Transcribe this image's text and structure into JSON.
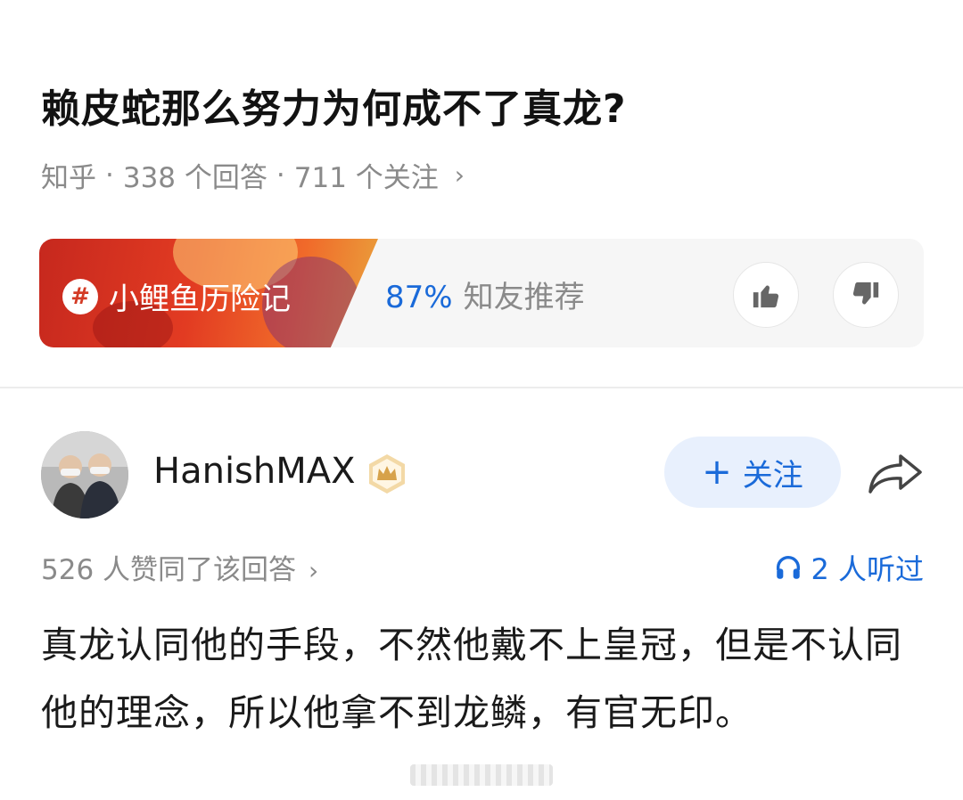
{
  "question": {
    "title": "赖皮蛇那么努力为何成不了真龙?",
    "source": "知乎",
    "answers": "338 个回答",
    "followers": "711 个关注"
  },
  "topic": {
    "tag": "小鲤鱼历险记",
    "recommend_pct": "87%",
    "recommend_label": "知友推荐"
  },
  "author": {
    "name": "HanishMAX",
    "follow_label": "关注"
  },
  "answer": {
    "likes": "526 人赞同了该回答",
    "listened": "2 人听过",
    "text": "真龙认同他的手段，不然他戴不上皇冠，但是不认同他的理念，所以他拿不到龙鳞，有官无印。"
  },
  "colors": {
    "accent": "#1a6ad9",
    "meta_gray": "#8a8a8a",
    "follow_bg": "#e8f0fd",
    "topic_red": "#d33b25"
  },
  "icons": [
    "hash-icon",
    "thumbs-up-icon",
    "thumbs-down-icon",
    "crown-badge-icon",
    "share-icon",
    "headphones-icon",
    "chevron-right-icon"
  ]
}
